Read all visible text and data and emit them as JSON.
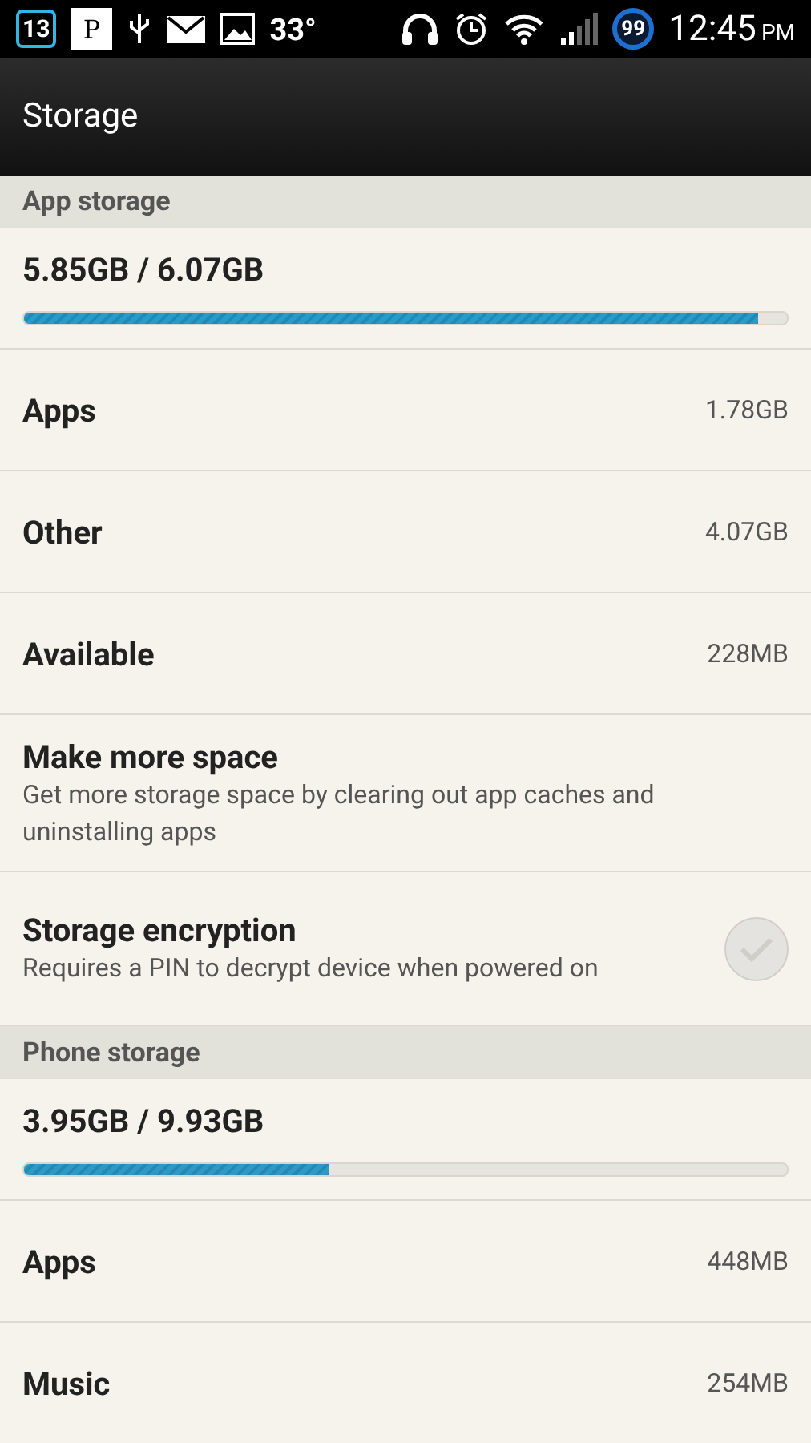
{
  "status_bar": {
    "calendar_day": "13",
    "notification_letter": "P",
    "temperature": "33°",
    "badge_count": "99",
    "time": "12:45",
    "am_pm": "PM"
  },
  "title": "Storage",
  "sections": [
    {
      "header": "App storage",
      "items": [
        {
          "kind": "usage",
          "label": "5.85GB / 6.07GB",
          "level": 0.962
        },
        {
          "kind": "value",
          "label": "Apps",
          "value": "1.78GB"
        },
        {
          "kind": "value",
          "label": "Other",
          "value": "4.07GB"
        },
        {
          "kind": "value",
          "label": "Available",
          "value": "228MB"
        },
        {
          "kind": "action",
          "label": "Make more space",
          "summary": "Get more storage space by clearing out app caches and uninstalling apps"
        },
        {
          "kind": "toggle",
          "label": "Storage encryption",
          "summary": "Requires a PIN to decrypt device when powered on",
          "checked": false
        }
      ]
    },
    {
      "header": "Phone storage",
      "items": [
        {
          "kind": "usage",
          "label": "3.95GB / 9.93GB",
          "level": 0.4
        },
        {
          "kind": "value",
          "label": "Apps",
          "value": "448MB"
        },
        {
          "kind": "value",
          "label": "Music",
          "value": "254MB"
        }
      ]
    }
  ]
}
